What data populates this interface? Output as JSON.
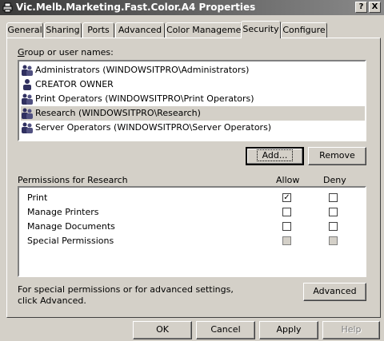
{
  "window": {
    "title": "Vic.Melb.Marketing.Fast.Color.A4 Properties",
    "help_button": "?",
    "close_button": "X"
  },
  "tabs": [
    {
      "label": "General",
      "active": false
    },
    {
      "label": "Sharing",
      "active": false
    },
    {
      "label": "Ports",
      "active": false
    },
    {
      "label": "Advanced",
      "active": false
    },
    {
      "label": "Color Management",
      "active": false
    },
    {
      "label": "Security",
      "active": true
    },
    {
      "label": "Configure",
      "active": false
    }
  ],
  "security": {
    "group_label": "Group or user names:",
    "users": [
      {
        "name": "Administrators (WINDOWSITPRO\\Administrators)",
        "selected": false
      },
      {
        "name": "CREATOR OWNER",
        "selected": false
      },
      {
        "name": "Print Operators (WINDOWSITPRO\\Print Operators)",
        "selected": false
      },
      {
        "name": "Research (WINDOWSITPRO\\Research)",
        "selected": true
      },
      {
        "name": "Server Operators (WINDOWSITPRO\\Server Operators)",
        "selected": false
      }
    ],
    "add_button": "Add...",
    "remove_button": "Remove",
    "permissions_label": "Permissions for Research",
    "allow_header": "Allow",
    "deny_header": "Deny",
    "permissions": [
      {
        "name": "Print",
        "allow": true,
        "deny": false,
        "greyed": false
      },
      {
        "name": "Manage Printers",
        "allow": false,
        "deny": false,
        "greyed": false
      },
      {
        "name": "Manage Documents",
        "allow": false,
        "deny": false,
        "greyed": false
      },
      {
        "name": "Special Permissions",
        "allow": false,
        "deny": false,
        "greyed": true
      }
    ],
    "advanced_note_line1": "For special permissions or for advanced settings,",
    "advanced_note_line2": "click Advanced.",
    "advanced_button": "Advanced"
  },
  "footer": {
    "ok": "OK",
    "cancel": "Cancel",
    "apply": "Apply",
    "help": "Help"
  },
  "colors": {
    "face": "#d4d0c8",
    "title_gradient_start": "#3a3a3a",
    "title_gradient_end": "#8a8a8a"
  }
}
